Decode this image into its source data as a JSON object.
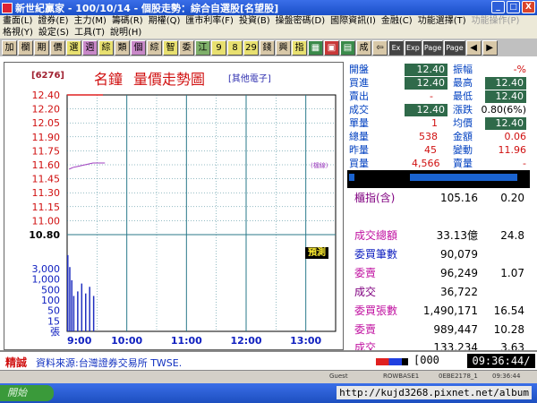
{
  "window": {
    "title": "新世紀贏家 - 100/10/14 - 個股走勢：綜合自選股[名望股]",
    "buttons": [
      "_",
      "□",
      "X"
    ]
  },
  "menu1": [
    "畫面(L)",
    "證券(E)",
    "主力(M)",
    "籌碼(R)",
    "期權(Q)",
    "匯市利率(F)",
    "投資(B)",
    "操盤密碼(D)",
    "國際資訊(I)",
    "金融(C)",
    "功能選擇(T)",
    "功能操作(P)"
  ],
  "menu2": [
    "格視(Y)",
    "設定(S)",
    "工具(T)",
    "說明(H)"
  ],
  "toolbar": [
    "加",
    "欄",
    "期",
    "價",
    "選",
    "週",
    "綜",
    "類",
    "個",
    "綜",
    "智",
    "委",
    "江",
    "9",
    "8",
    "29",
    "錢",
    "興",
    "指",
    "",
    "",
    "",
    "成",
    "",
    "Ex",
    "Exp",
    "Page",
    "Page",
    "",
    ""
  ],
  "chart_header": {
    "code": "[6276]",
    "name": "名鐘",
    "title": "量價走勢圖",
    "other": "[其他電子]",
    "annotation": "(檔線)",
    "pred_label": "預測"
  },
  "chart_data": {
    "type": "line",
    "price_ticks": [
      "12.40",
      "12.20",
      "12.05",
      "11.90",
      "11.75",
      "11.60",
      "11.45",
      "11.30",
      "11.15",
      "11.00",
      "10.80"
    ],
    "volume_ticks": [
      "3,000",
      "1,000",
      "500",
      "100",
      "50",
      "15",
      "張"
    ],
    "x_ticks": [
      "9:00",
      "10:00",
      "11:00",
      "12:00",
      "13:00"
    ],
    "reference_price": 10.8,
    "limit_up": 12.4,
    "avg_line": 11.6,
    "ylim": [
      10.8,
      12.4
    ],
    "price_series": {
      "x": [
        0,
        0.5,
        1,
        2,
        3,
        4,
        5,
        6,
        8,
        10,
        12,
        14,
        16,
        18,
        20,
        22,
        24,
        26,
        28,
        30,
        32,
        36
      ],
      "y": [
        12.4,
        12.4,
        12.4,
        12.4,
        12.4,
        12.4,
        12.4,
        12.4,
        12.4,
        12.4,
        12.4,
        12.4,
        12.4,
        12.4,
        12.4,
        12.4,
        12.4,
        12.4,
        12.4,
        12.4,
        12.4,
        12.4
      ]
    },
    "avg_series": {
      "x": [
        2,
        6,
        10,
        14,
        18,
        22,
        26,
        30,
        34,
        38
      ],
      "y": [
        11.55,
        11.57,
        11.58,
        11.59,
        11.6,
        11.61,
        11.62,
        11.62,
        11.62,
        11.62
      ]
    },
    "volume_bars": {
      "x": [
        0,
        2,
        4,
        6,
        10,
        14,
        18,
        22,
        26
      ],
      "v": [
        700,
        250,
        80,
        20,
        30,
        60,
        25,
        45,
        20
      ]
    },
    "minutes_total": 270
  },
  "quote": {
    "rows": [
      {
        "l1": "開盤",
        "v1": "12.40",
        "l2": "振幅",
        "v2": "-%"
      },
      {
        "l1": "買進",
        "v1": "12.40",
        "l2": "最高",
        "v2": "12.40"
      },
      {
        "l1": "賣出",
        "v1": "-",
        "l2": "最低",
        "v2": "12.40"
      },
      {
        "l1": "成交",
        "v1": "12.40",
        "l2": "漲跌",
        "v2": "0.80(6%)"
      },
      {
        "l1": "單量",
        "v1": "1",
        "l2": "均價",
        "v2": "12.40"
      },
      {
        "l1": "總量",
        "v1": "538",
        "l2": "金額",
        "v2": "0.06"
      },
      {
        "l1": "昨量",
        "v1": "45",
        "l2": "變動",
        "v2": "11.96"
      },
      {
        "l1": "買量",
        "v1": "4,566",
        "l2": "賣量",
        "v2": "-"
      }
    ]
  },
  "market": {
    "rows": [
      {
        "label": "櫃指(含)",
        "v1": "105.16",
        "v2": "0.20"
      },
      {
        "label": "成交總額",
        "v1": "33.13億",
        "v2": "24.8"
      },
      {
        "label": "委買筆數",
        "v1": "90,079",
        "v2": ""
      },
      {
        "label": "委賣",
        "v1": "96,249",
        "v2": "1.07"
      },
      {
        "label": "成交",
        "v1": "36,722",
        "v2": ""
      },
      {
        "label": "委買張數",
        "v1": "1,490,171",
        "v2": "16.54"
      },
      {
        "label": "委賣",
        "v1": "989,447",
        "v2": "10.28"
      },
      {
        "label": "成交",
        "v1": "133,234",
        "v2": "3.63"
      }
    ]
  },
  "status": {
    "label": "精誠",
    "source": "資料來源:台灣證券交易所 TWSE.",
    "count": "[000",
    "clock": "09:36:44/"
  },
  "strip": [
    "Guest",
    "ROWBASE1",
    "0EBE2178_1",
    "09:36:44"
  ],
  "taskbar": {
    "start": "開始",
    "url": "http://kujd3268.pixnet.net/album"
  },
  "colors": {
    "price_line": "#e02020",
    "avg_line": "#a040c0",
    "reference": "#000000",
    "grid": "#2a7a8a",
    "volume": "#2030c0"
  }
}
